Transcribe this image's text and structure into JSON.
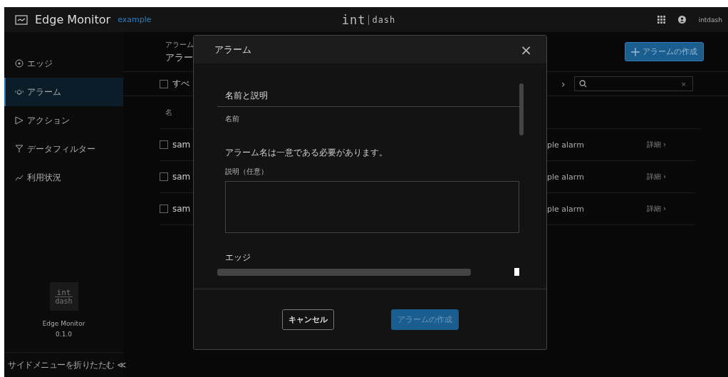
{
  "header": {
    "app_title": "Edge Monitor",
    "tenant": "example",
    "logo": {
      "top": "int",
      "bottom": "dash"
    },
    "user": "intdash"
  },
  "sidebar": {
    "items": [
      {
        "label": "エッジ",
        "selected": false
      },
      {
        "label": "アラーム",
        "selected": true
      },
      {
        "label": "アクション",
        "selected": false
      },
      {
        "label": "データフィルター",
        "selected": false
      },
      {
        "label": "利用状況",
        "selected": false
      }
    ],
    "logo": {
      "top": "int",
      "bottom": "dash"
    },
    "app_name": "Edge Monitor",
    "version": "0.1.0",
    "collapse": "サイドメニューを折りたたむ",
    "collapse_icon": "≪"
  },
  "page": {
    "breadcrumb": "アラーム",
    "title": "アラー",
    "create_button": "アラームの作成",
    "select_all": {
      "label": "すべ",
      "checked": false
    },
    "next_icon": "›",
    "search": {
      "clear": "×"
    },
    "column_1": "名",
    "rows": [
      {
        "left": "sam",
        "right": "ple alarm",
        "detail": "詳細 ›",
        "checked": false
      },
      {
        "left": "sam",
        "right": "ple alarm",
        "detail": "詳細 ›",
        "checked": false
      },
      {
        "left": "sam",
        "right": "ple alarm",
        "detail": "詳細 ›",
        "checked": false
      }
    ]
  },
  "dialog": {
    "title": "アラーム",
    "close": "×",
    "section_1": "名前と説明",
    "name_label": "名前",
    "name_hint": "アラーム名は一意である必要があります。",
    "description_label": "説明（任意）",
    "section_2": "エッジ",
    "buttons": [
      {
        "label": "キャンセル",
        "kind": "secondary",
        "disabled": false
      },
      {
        "label": "アラームの作成",
        "kind": "primary",
        "disabled": true
      }
    ]
  }
}
